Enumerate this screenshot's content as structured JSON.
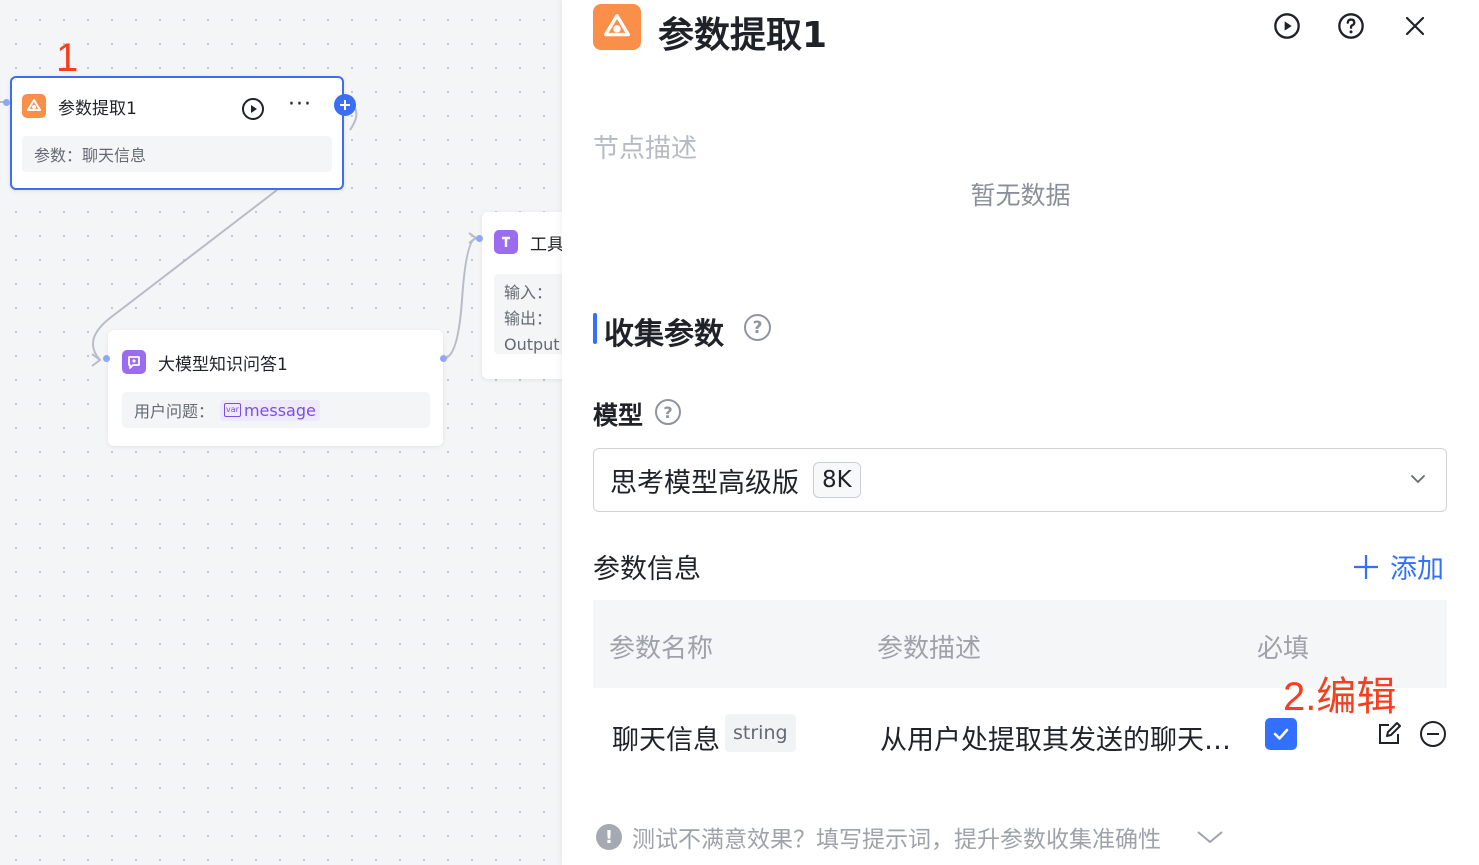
{
  "canvas": {
    "step_label": "1",
    "nodes": {
      "param_extract": {
        "title": "参数提取1",
        "body_label": "参数：",
        "body_value": "聊天信息",
        "more_label": "···"
      },
      "llm_qa": {
        "title": "大模型知识问答1",
        "body_label": "用户问题：",
        "var_badge": "var",
        "var_value": "message"
      },
      "tool": {
        "title_partial": "工具",
        "input_label": "输入：",
        "output_label": "输出：",
        "output_value_partial": "Output"
      }
    }
  },
  "panel": {
    "title": "参数提取1",
    "description_placeholder": "节点描述",
    "empty_text": "暂无数据",
    "section_title": "收集参数",
    "model_label": "模型",
    "model_value": "思考模型高级版",
    "model_badge": "8K",
    "param_info_label": "参数信息",
    "add_label": "添加",
    "table": {
      "headers": [
        "参数名称",
        "参数描述",
        "必填"
      ],
      "rows": [
        {
          "name": "聊天信息",
          "type": "string",
          "description": "从用户处提取其发送的聊天信息",
          "required": true
        }
      ]
    },
    "edit_annotation": "2.编辑",
    "tip_text": "测试不满意效果？填写提示词，提升参数收集准确性"
  },
  "colors": {
    "accent": "#3370ff",
    "annotation": "#f53f1e",
    "param_icon": "#fa8f4a",
    "llm_icon": "#9b6cf0",
    "tool_icon": "#9b6cf0"
  }
}
